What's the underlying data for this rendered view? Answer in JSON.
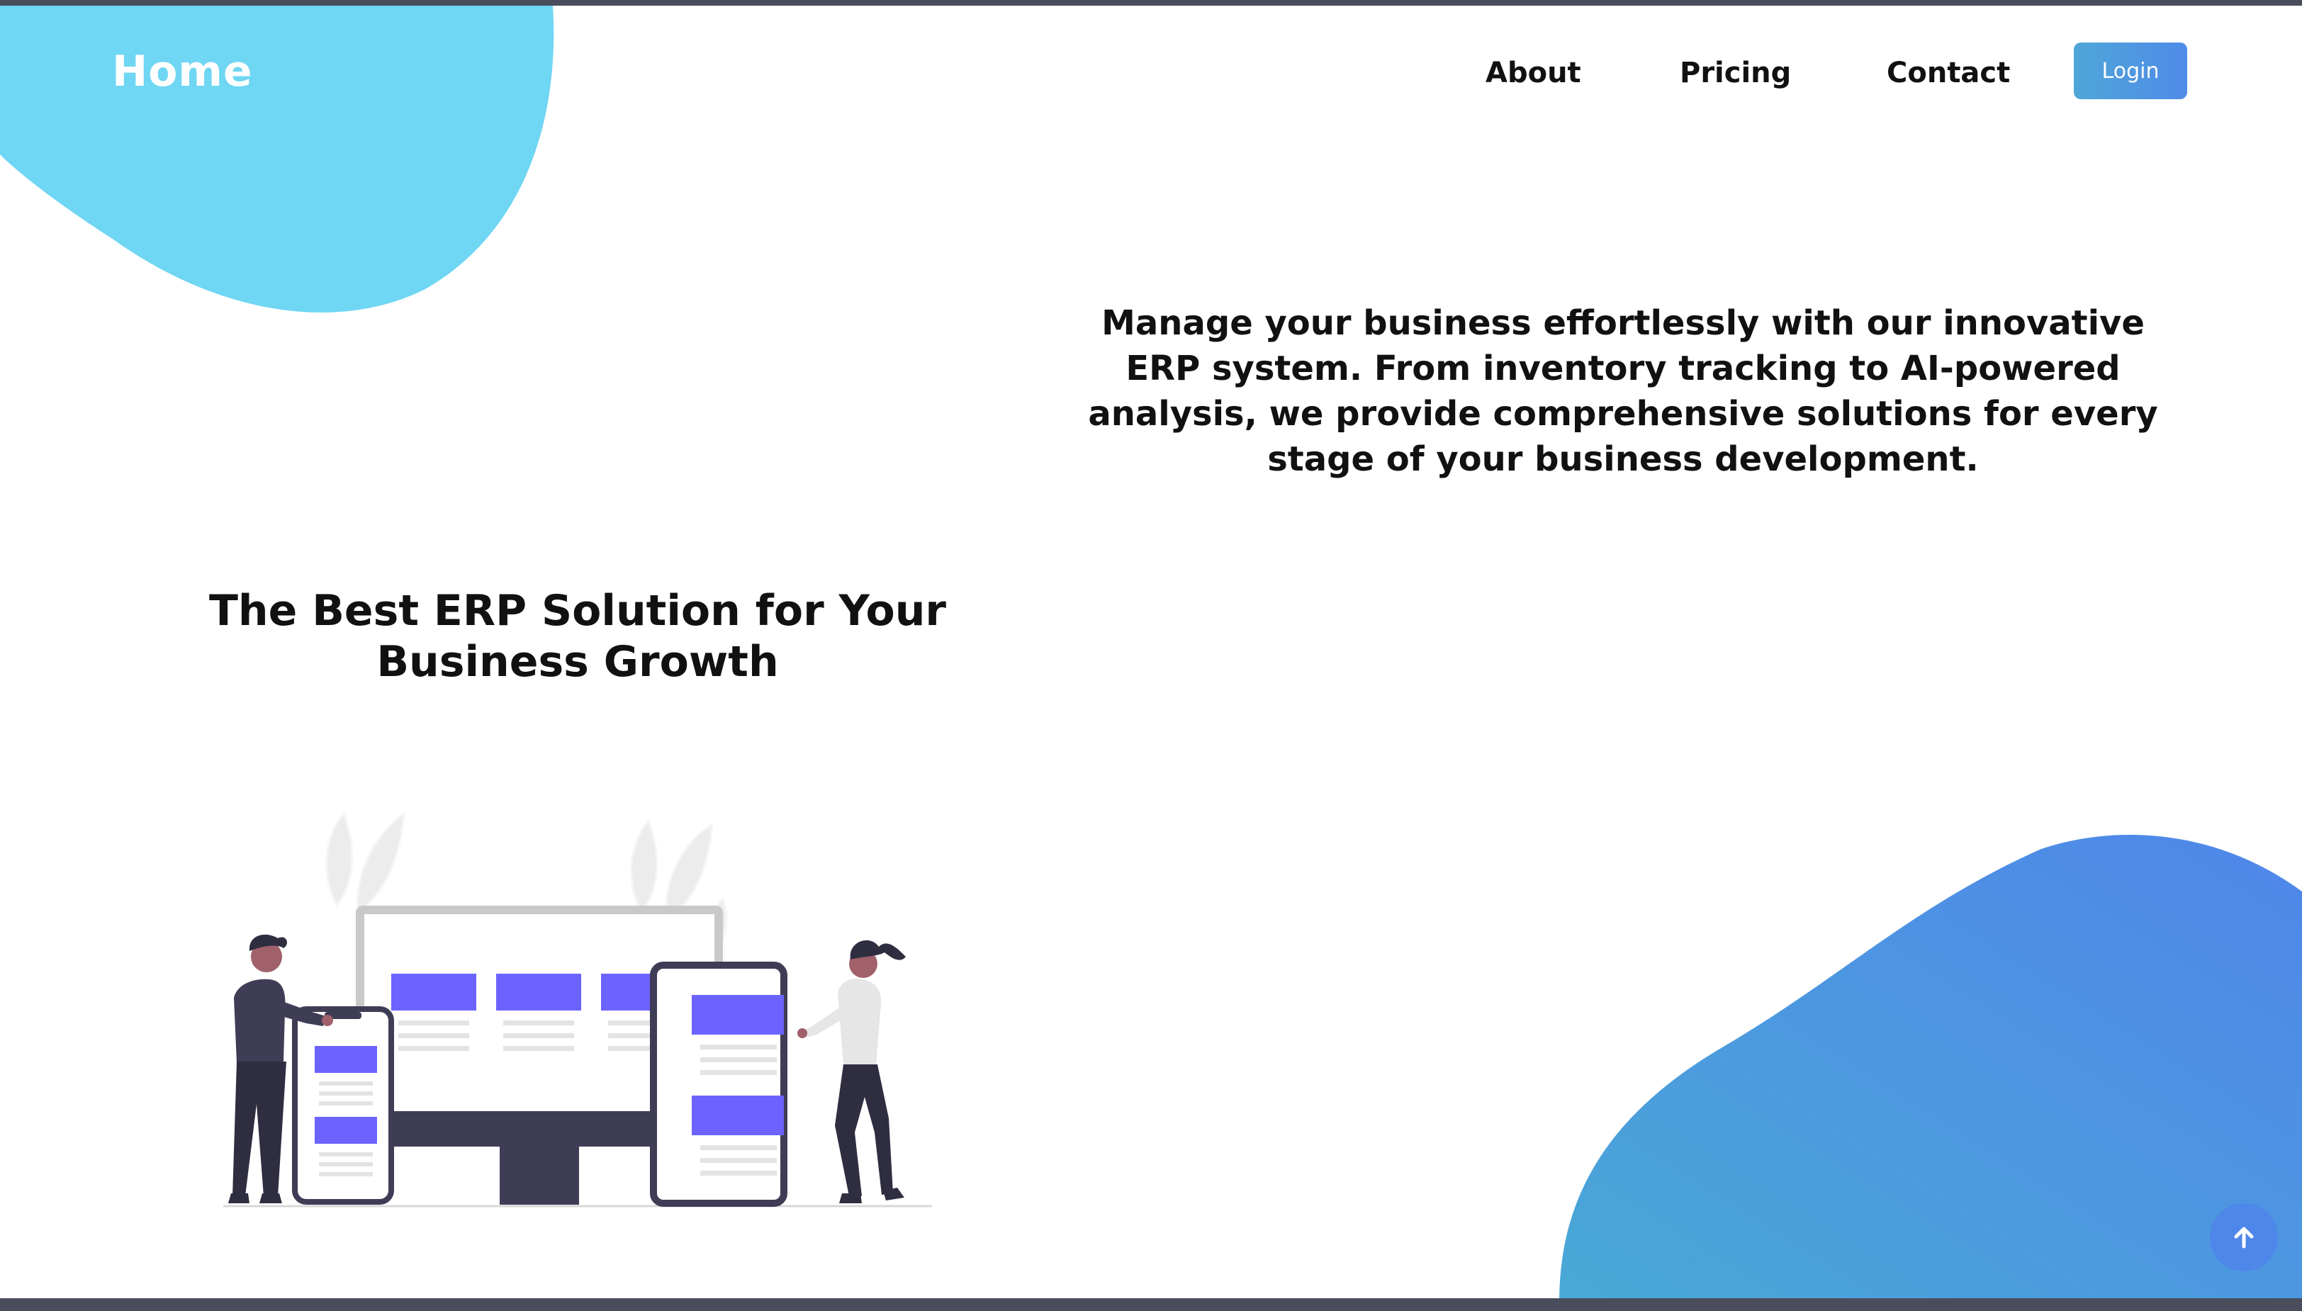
{
  "navbar": {
    "logo": "Home",
    "links": [
      "About",
      "Pricing",
      "Contact"
    ],
    "login_label": "Login"
  },
  "hero": {
    "description": "Manage your business effortlessly with our innovative ERP system. From inventory tracking to AI-powered analysis, we provide comprehensive solutions for every stage of your business development.",
    "headline": "The Best ERP Solution for Your Business Growth"
  },
  "illustration": {
    "icon": "people-with-devices-illustration",
    "accent_color": "#6c63ff"
  },
  "scroll_top": {
    "icon": "arrow-up-icon"
  },
  "colors": {
    "blob_top": "#6fd6f3",
    "blob_bottom_start": "#4aa8d6",
    "blob_bottom_end": "#4f86ea",
    "login_button": "#4f8be8",
    "text": "#111111"
  }
}
